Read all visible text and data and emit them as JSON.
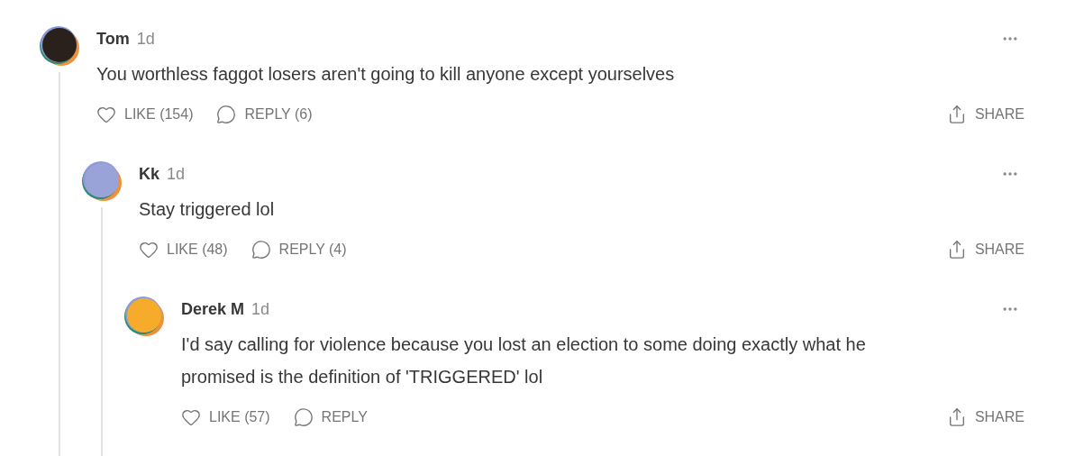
{
  "comments": [
    {
      "author": "Tom",
      "time": "1d",
      "color": "#2b211c",
      "text": "You worthless faggot losers aren't going to kill anyone except yourselves",
      "like": "LIKE (154)",
      "reply": "REPLY (6)",
      "share": "SHARE",
      "children": [
        {
          "author": "Kk",
          "time": "1d",
          "color": "#9aa3d8",
          "text": "Stay triggered lol",
          "like": "LIKE (48)",
          "reply": "REPLY (4)",
          "share": "SHARE",
          "children": [
            {
              "author": "Derek M",
              "time": "1d",
              "color": "#f6ac2a",
              "text": "I'd say calling for violence because you lost an election to some doing exactly what he promised is the definition of 'TRIGGERED' lol",
              "like": "LIKE (57)",
              "reply": "REPLY",
              "share": "SHARE"
            }
          ]
        }
      ]
    }
  ]
}
